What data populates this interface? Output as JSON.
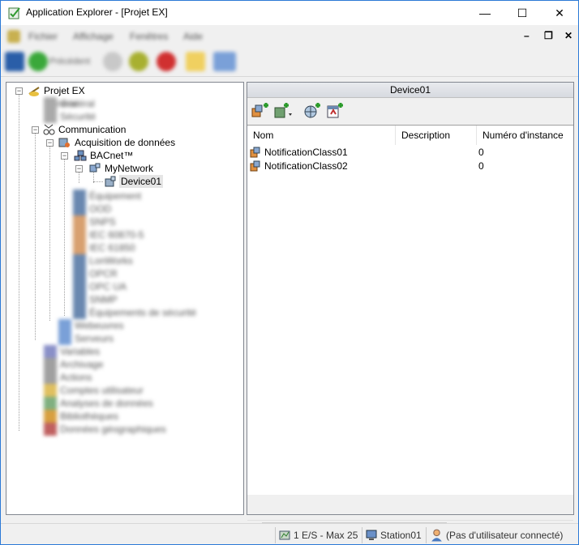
{
  "window": {
    "title": "Application Explorer - [Projet EX]",
    "controls": {
      "minimize": "—",
      "maximize": "☐",
      "close": "✕"
    }
  },
  "menu": {
    "items": [
      "Fichier",
      "Affichage",
      "Fenêtres",
      "Aide"
    ],
    "mdi": {
      "minimize": "–",
      "restore": "❐",
      "close": "✕"
    }
  },
  "toolbar": {
    "back_label": "Précédent"
  },
  "tree": {
    "root": "Projet EX",
    "visible": [
      {
        "label": "Communication",
        "icon": "communication-icon"
      },
      {
        "label": "Acquisition de données",
        "icon": "acquisition-icon"
      },
      {
        "label": "BACnet™",
        "icon": "bacnet-icon"
      },
      {
        "label": "MyNetwork",
        "icon": "network-icon"
      },
      {
        "label": "Device01",
        "icon": "device-icon",
        "selected": true
      }
    ],
    "blurred": [
      "Général",
      "Sécurité",
      "Équipement",
      "OOD",
      "SNPS",
      "IEC 60870-5",
      "IEC 61850",
      "LonWorks",
      "OPCR",
      "OPC UA",
      "SNMP",
      "Équipements de sécurité",
      "Webeuvres",
      "Serveurs",
      "Variables",
      "Archivage",
      "Actions",
      "Comptes utilisateur",
      "Analyses de données",
      "Bibliothèques",
      "Données géographiques"
    ]
  },
  "panel": {
    "title": "Device01",
    "tools": [
      "add-object-icon",
      "add-dropdown-icon",
      "add-globe-icon",
      "add-calendar-icon"
    ],
    "columns": [
      "Nom",
      "Description",
      "Numéro d'instance"
    ],
    "rows": [
      {
        "name": "NotificationClass01",
        "description": "",
        "instance": "0"
      },
      {
        "name": "NotificationClass02",
        "description": "",
        "instance": "0"
      }
    ]
  },
  "status": {
    "io": "1 E/S - Max 25",
    "station": "Station01",
    "user": "(Pas d'utilisateur connecté)"
  }
}
